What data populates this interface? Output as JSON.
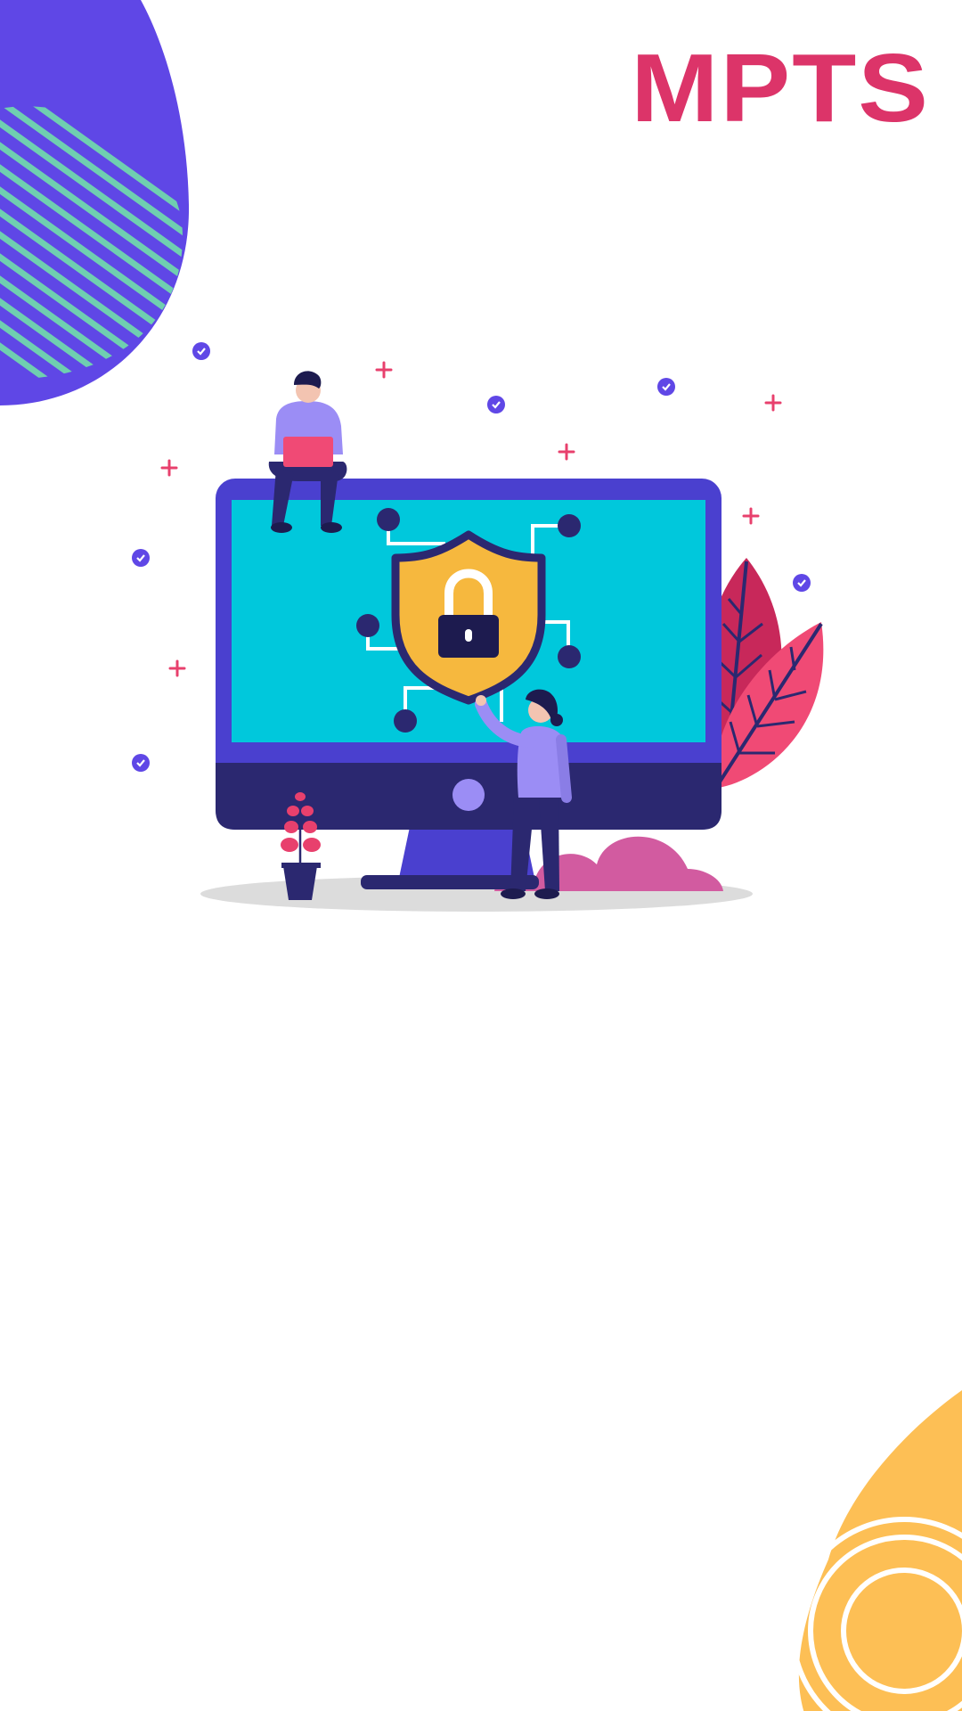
{
  "app": {
    "brand_name": "MPTS"
  },
  "colors": {
    "brand": "#dc3469",
    "blob_purple": "#5f47e6",
    "stripe_teal": "#6fcfb0",
    "blob_orange": "#fdbf55",
    "monitor_frame": "#4a40cf",
    "monitor_base": "#2b2870",
    "screen": "#00c8dc",
    "shield": "#f6b83e",
    "leaf": "#e8406d",
    "bush": "#d25ba0"
  },
  "illustration": {
    "subject": "cyber-security-monitor",
    "icons": [
      "shield-lock-icon",
      "check-badge-icon",
      "plus-sparkle-icon",
      "leaf-icon",
      "plant-pot-icon"
    ]
  }
}
